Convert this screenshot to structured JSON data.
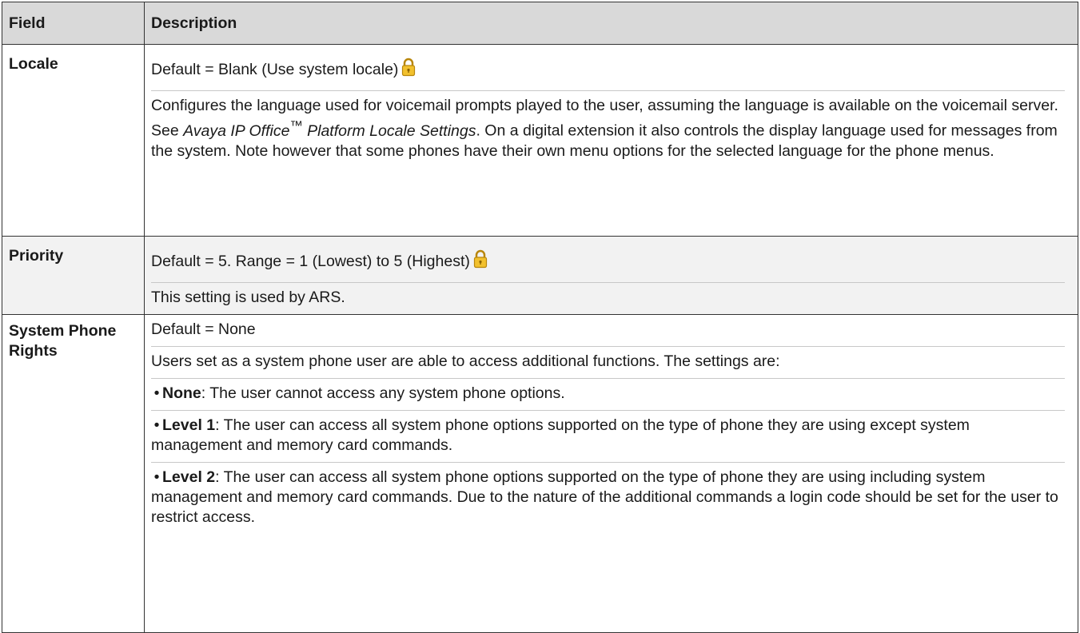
{
  "table": {
    "headers": {
      "field": "Field",
      "description": "Description"
    },
    "rows": {
      "locale": {
        "field": "Locale",
        "default": "Default = Blank (Use system locale)",
        "desc1": "Configures the language used for voicemail prompts played to the user, assuming the language is available on the voicemail server. See ",
        "doc_title": "Avaya IP Office",
        "tm": "™",
        "doc_title2": " Platform Locale Settings",
        "desc2": ". On a digital extension it also controls the display language used for messages from the system. Note however that some phones have their own menu options for the selected language for the phone menus."
      },
      "priority": {
        "field": "Priority",
        "default": "Default = 5. Range = 1 (Lowest) to 5 (Highest)",
        "desc": "This setting is used by ARS."
      },
      "system_phone_rights": {
        "field_line1": "System Phone",
        "field_line2": "Rights",
        "default": "Default = None",
        "intro": "Users set as a system phone user are able to access additional functions. The settings are:",
        "options": [
          {
            "term": "None",
            "text": ": The user cannot access any system phone options."
          },
          {
            "term": "Level 1",
            "text": ": The user can access all system phone options supported on the type of phone they are using except system management and memory card commands."
          },
          {
            "term": "Level 2",
            "text": ": The user can access all system phone options supported on the type of phone they are using including system management and memory card commands. Due to the nature of the additional commands a login code should be set for the user to restrict access."
          }
        ]
      }
    },
    "icons": {
      "lock": "lock-icon"
    }
  }
}
